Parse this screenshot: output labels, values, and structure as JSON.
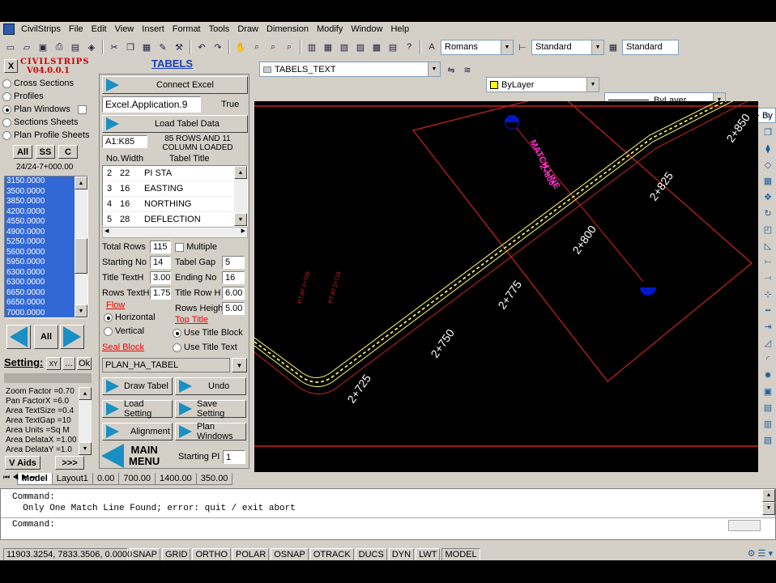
{
  "menubar": {
    "items": [
      "CivilStrips",
      "File",
      "Edit",
      "View",
      "Insert",
      "Format",
      "Tools",
      "Draw",
      "Dimension",
      "Modify",
      "Window",
      "Help"
    ]
  },
  "toolbar": {
    "text_style": "Romans",
    "dim_style": "Standard",
    "table_style": "Standard",
    "layer": "TABELS_TEXT",
    "color": "ByLayer",
    "linetype": "ByLayer",
    "lineweight": "By"
  },
  "panel": {
    "logo_line1": "CIVILSTRIPS",
    "logo_line2": "V04.0.0.1",
    "close": "X",
    "title": "TABELS",
    "options": [
      "Cross Sections",
      "Profiles",
      "Plan Windows",
      "Sections Sheets",
      "Plan Profile Sheets"
    ],
    "btn_all": "All",
    "btn_ss": "SS",
    "btn_c": "C",
    "station": "24/24-7+000.00",
    "station_list": [
      "3150.0000",
      "3500.0000",
      "3850.0000",
      "4200.0000",
      "4550.0000",
      "4900.0000",
      "5250.0000",
      "5600.0000",
      "5950.0000",
      "6300.0000",
      "6300.0000",
      "6650.0000",
      "6650.0000",
      "7000.0000"
    ],
    "nav_all": "All",
    "setting_label": "Setting:",
    "xy_btn": "XY",
    "dots_btn": "...",
    "ok_btn": "Ok",
    "settings": [
      "Zoom Factor =0.70",
      "Pan FactorX =6.0",
      "Area TextSize =0.4",
      "Area TextGap =10",
      "Area Units =Sq M",
      "Area DelataX =1.00",
      "Area DelataY =1.0"
    ],
    "vaids": "V Aids",
    "more": ">>>"
  },
  "tabels": {
    "connect_excel": "Connect Excel",
    "excel_app": "Excel.Application.9",
    "excel_status": "True",
    "load_data": "Load Tabel Data",
    "range": "A1:K85",
    "loaded_msg": "85 ROWS AND 11 COLUMN LOADED",
    "col_no": "No.",
    "col_width": "Width",
    "col_title": "Tabel Title",
    "rows": [
      {
        "no": "2",
        "width": "22",
        "title": "PI STA"
      },
      {
        "no": "3",
        "width": "16",
        "title": "EASTING"
      },
      {
        "no": "4",
        "width": "16",
        "title": "NORTHING"
      },
      {
        "no": "5",
        "width": "28",
        "title": "DEFLECTION"
      }
    ],
    "total_rows_label": "Total Rows",
    "total_rows": "115",
    "multiple_label": "Multiple",
    "starting_no_label": "Starting No",
    "starting_no": "14",
    "tabel_gap_label": "Tabel Gap",
    "tabel_gap": "5",
    "title_texth_label": "Title TextH",
    "title_texth": "3.00",
    "ending_no_label": "Ending No",
    "ending_no": "16",
    "rows_texth_label": "Rows TextH",
    "rows_texth": "1.75",
    "title_rowh_label": "Title Row H",
    "title_rowh": "6.00",
    "flow_label": "Flow",
    "rows_height_label": "Rows Height",
    "rows_height": "5.00",
    "horizontal": "Horizontal",
    "vertical": "Vertical",
    "top_title": "Top Title",
    "use_title_block": "Use Title Block",
    "seal_block": "Seal Block",
    "use_title_text": "Use Title Text",
    "block_name": "PLAN_HA_TABEL",
    "draw_tabel": "Draw Tabel",
    "undo": "Undo",
    "load_setting": "Load Setting",
    "save_setting": "Save Setting",
    "alignment": "Alignment",
    "plan_windows": "Plan Windows",
    "main_menu_1": "MAIN",
    "main_menu_2": "MENU",
    "starting_pi_label": "Starting PI",
    "starting_pi": "1"
  },
  "drawing": {
    "match_line_1": "MATCH LINE",
    "match_line_2": "2+800",
    "stations": [
      "2+725",
      "2+750",
      "2+775",
      "2+800",
      "2+825",
      "2+850"
    ],
    "pt_label_1": "PT AT 2+709",
    "pt_label_2": "PT AT 2+716",
    "colors": {
      "background": "#000000",
      "road": "#ffff66",
      "frame": "#cc2222",
      "tick": "#ffffff",
      "label": "#ff33cc"
    }
  },
  "layout_tabs": [
    "Model",
    "Layout1",
    "0.00",
    "700.00",
    "1400.00",
    "350.00"
  ],
  "command": {
    "line1": "Command:",
    "line2": "  Only One Match Line Found; error: quit / exit abort",
    "line3": "Command:"
  },
  "status": {
    "coords": "11903.3254, 7833.3506, 0.0000",
    "toggles": [
      "SNAP",
      "GRID",
      "ORTHO",
      "POLAR",
      "OSNAP",
      "OTRACK",
      "DUCS",
      "DYN",
      "LWT",
      "MODEL"
    ]
  }
}
